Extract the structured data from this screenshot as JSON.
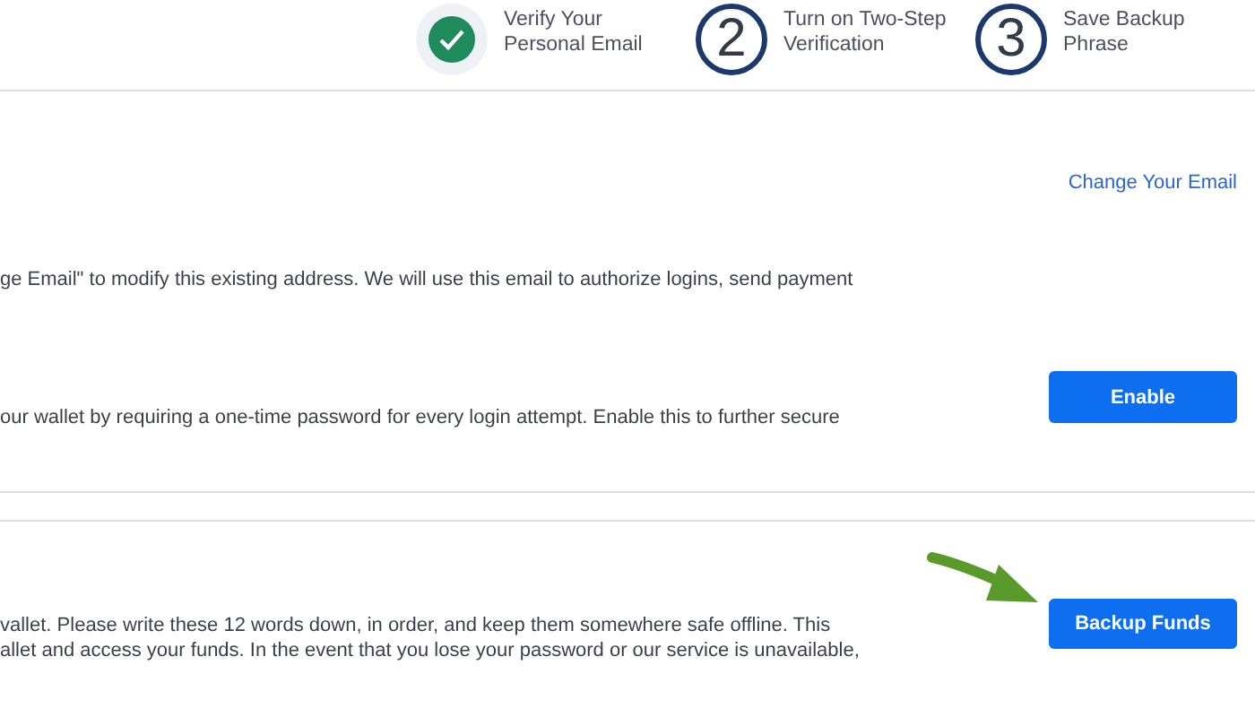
{
  "steps": [
    {
      "done": true,
      "label": [
        "Verify Your",
        "Personal Email"
      ]
    },
    {
      "done": false,
      "number": "2",
      "label": [
        "Turn on Two-Step",
        "Verification"
      ]
    },
    {
      "done": false,
      "number": "3",
      "label": [
        "Save Backup",
        "Phrase"
      ]
    }
  ],
  "sections": [
    {
      "description": [
        "ge Email\" to modify this existing address. We will use this email to authorize logins, send payment"
      ],
      "action": {
        "kind": "link",
        "label": "Change Your Email"
      },
      "pointer_arrow": false
    },
    {
      "description": [
        "our wallet by requiring a one-time password for every login attempt. Enable this to further secure"
      ],
      "action": {
        "kind": "button",
        "label": "Enable"
      },
      "pointer_arrow": false
    },
    {
      "description": [
        "vallet. Please write these 12 words down, in order, and keep them somewhere safe offline. This",
        "allet and access your funds. In the event that you lose your password or our service is unavailable,"
      ],
      "action": {
        "kind": "button",
        "label": "Backup Funds"
      },
      "pointer_arrow": true
    }
  ]
}
